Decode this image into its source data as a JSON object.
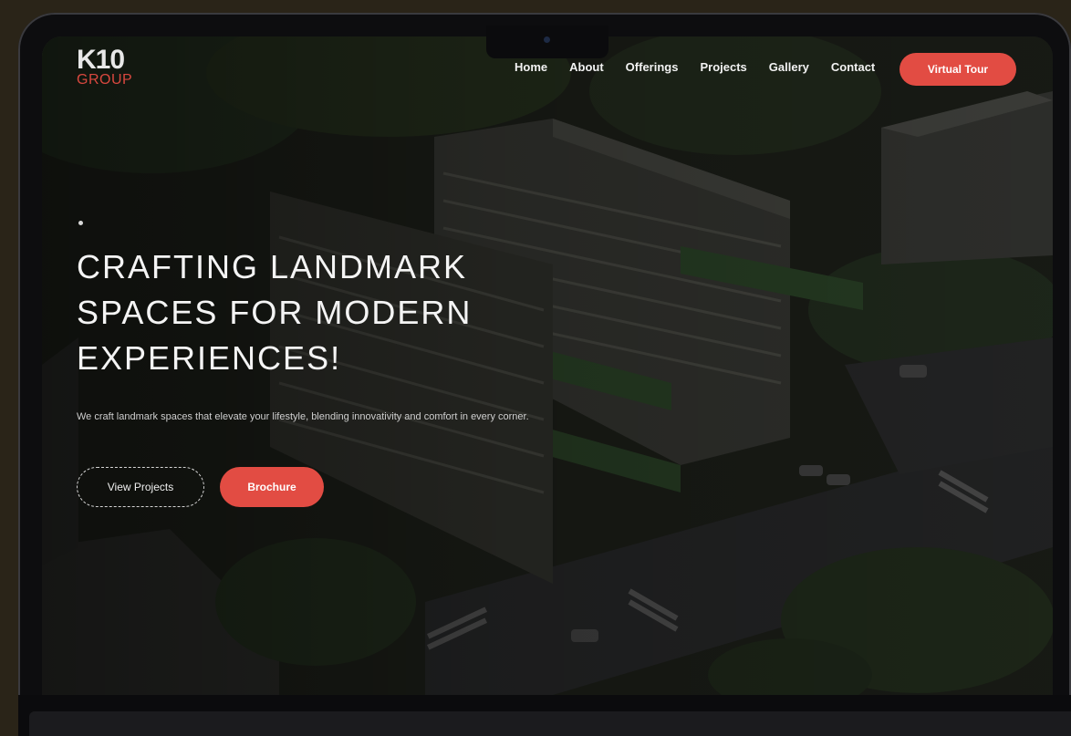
{
  "header": {
    "logo_mark": "K10",
    "logo_sub": "GROUP",
    "nav": [
      {
        "label": "Home"
      },
      {
        "label": "About"
      },
      {
        "label": "Offerings"
      },
      {
        "label": "Projects"
      },
      {
        "label": "Gallery"
      },
      {
        "label": "Contact"
      }
    ],
    "cta_label": "Virtual Tour"
  },
  "hero": {
    "eyebrow": "",
    "title_lines": [
      "CRAFTING LANDMARK",
      "SPACES FOR MODERN",
      "EXPERIENCES!"
    ],
    "description": "We craft landmark spaces that elevate your lifestyle, blending innovativity and comfort in every corner.",
    "primary_button": "View Projects",
    "secondary_button": "Brochure"
  },
  "colors": {
    "accent": "#e24c43",
    "logo_red": "#d9483f",
    "bezel": "#0d0d0f",
    "backdrop": "#2a2418"
  }
}
